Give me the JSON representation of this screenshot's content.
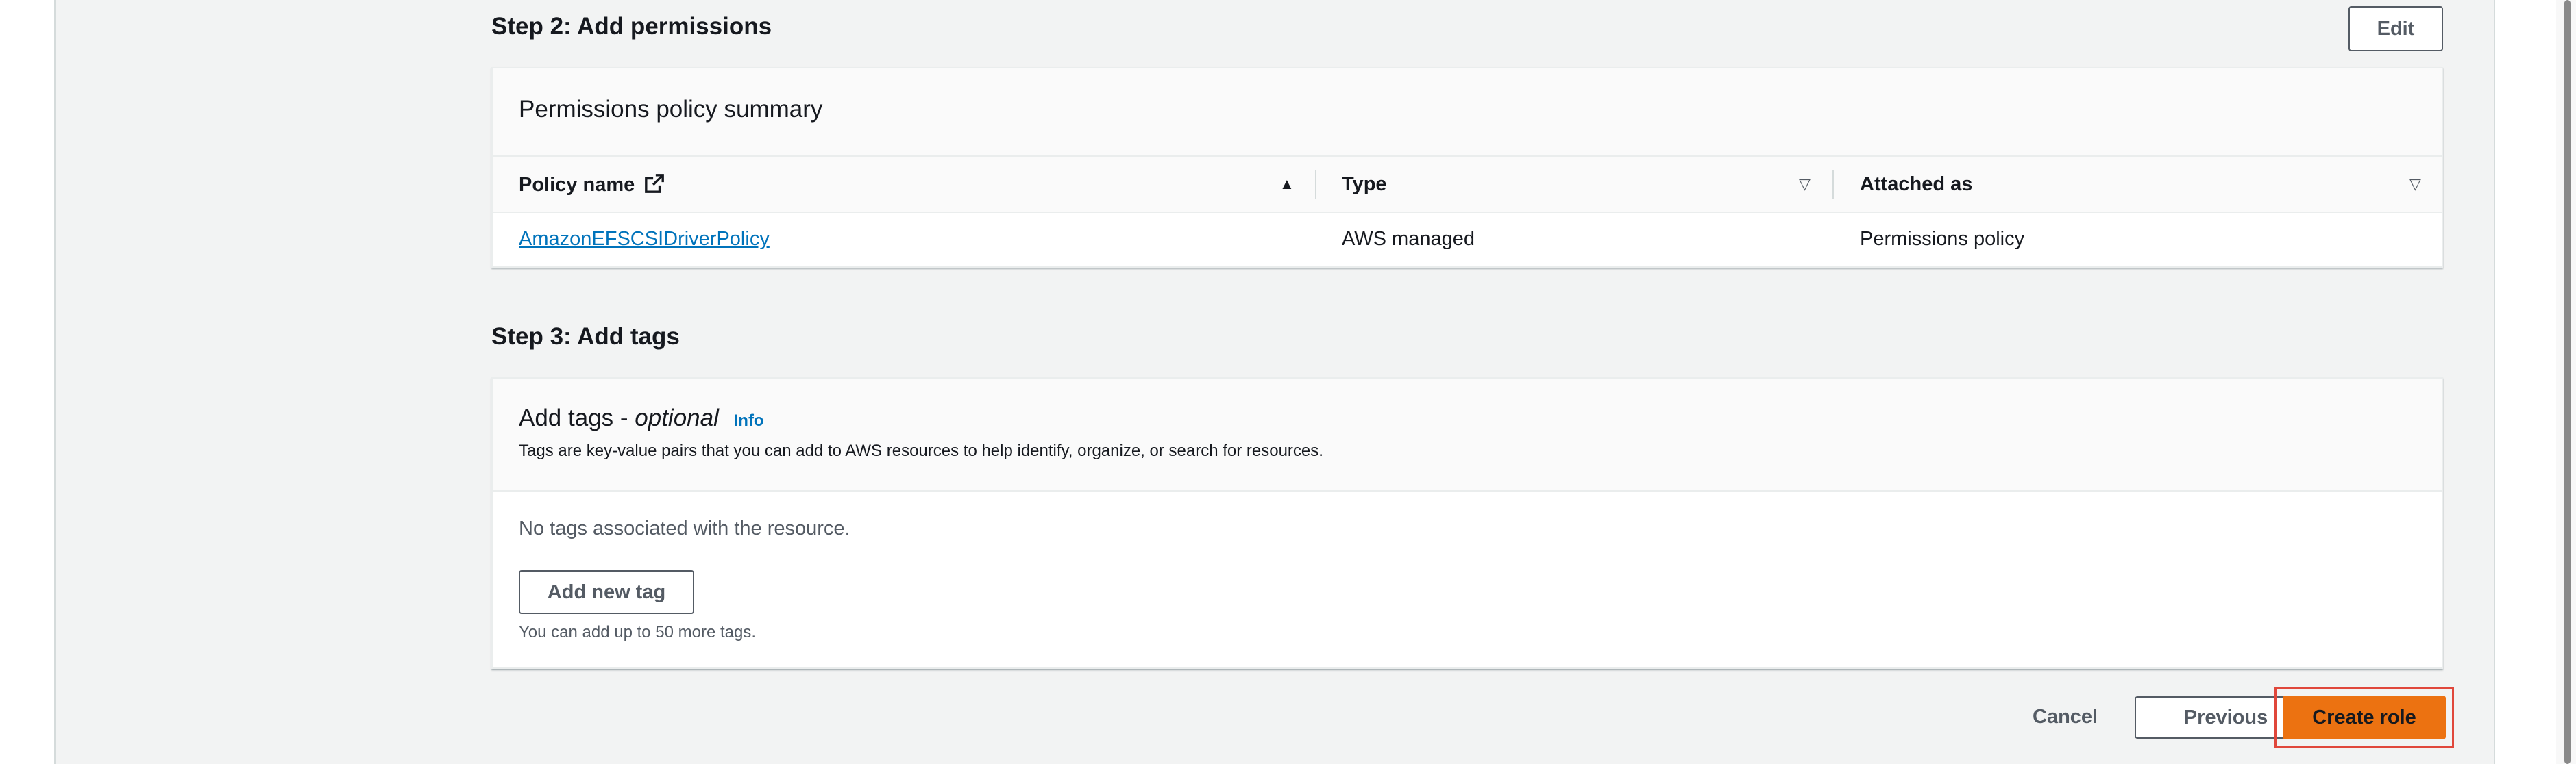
{
  "step2": {
    "title": "Step 2: Add permissions",
    "edit_label": "Edit",
    "card_title": "Permissions policy summary",
    "columns": [
      "Policy name",
      "Type",
      "Attached as"
    ],
    "rows": [
      {
        "policy_name": "AmazonEFSCSIDriverPolicy",
        "type": "AWS managed",
        "attached_as": "Permissions policy"
      }
    ]
  },
  "step3": {
    "title": "Step 3: Add tags",
    "card_title_main": "Add tags - ",
    "card_title_optional": "optional",
    "info_label": "Info",
    "description": "Tags are key-value pairs that you can add to AWS resources to help identify, organize, or search for resources.",
    "empty_text": "No tags associated with the resource.",
    "add_tag_label": "Add new tag",
    "limit_text": "You can add up to 50 more tags."
  },
  "footer": {
    "cancel_label": "Cancel",
    "previous_label": "Previous",
    "create_label": "Create role"
  },
  "colors": {
    "primary": "#ec7211",
    "link": "#0073bb",
    "highlight": "#e0473b"
  },
  "icons": {
    "external": "external-link-icon",
    "sort_asc": "sort-ascending-icon",
    "sort": "sort-icon"
  }
}
